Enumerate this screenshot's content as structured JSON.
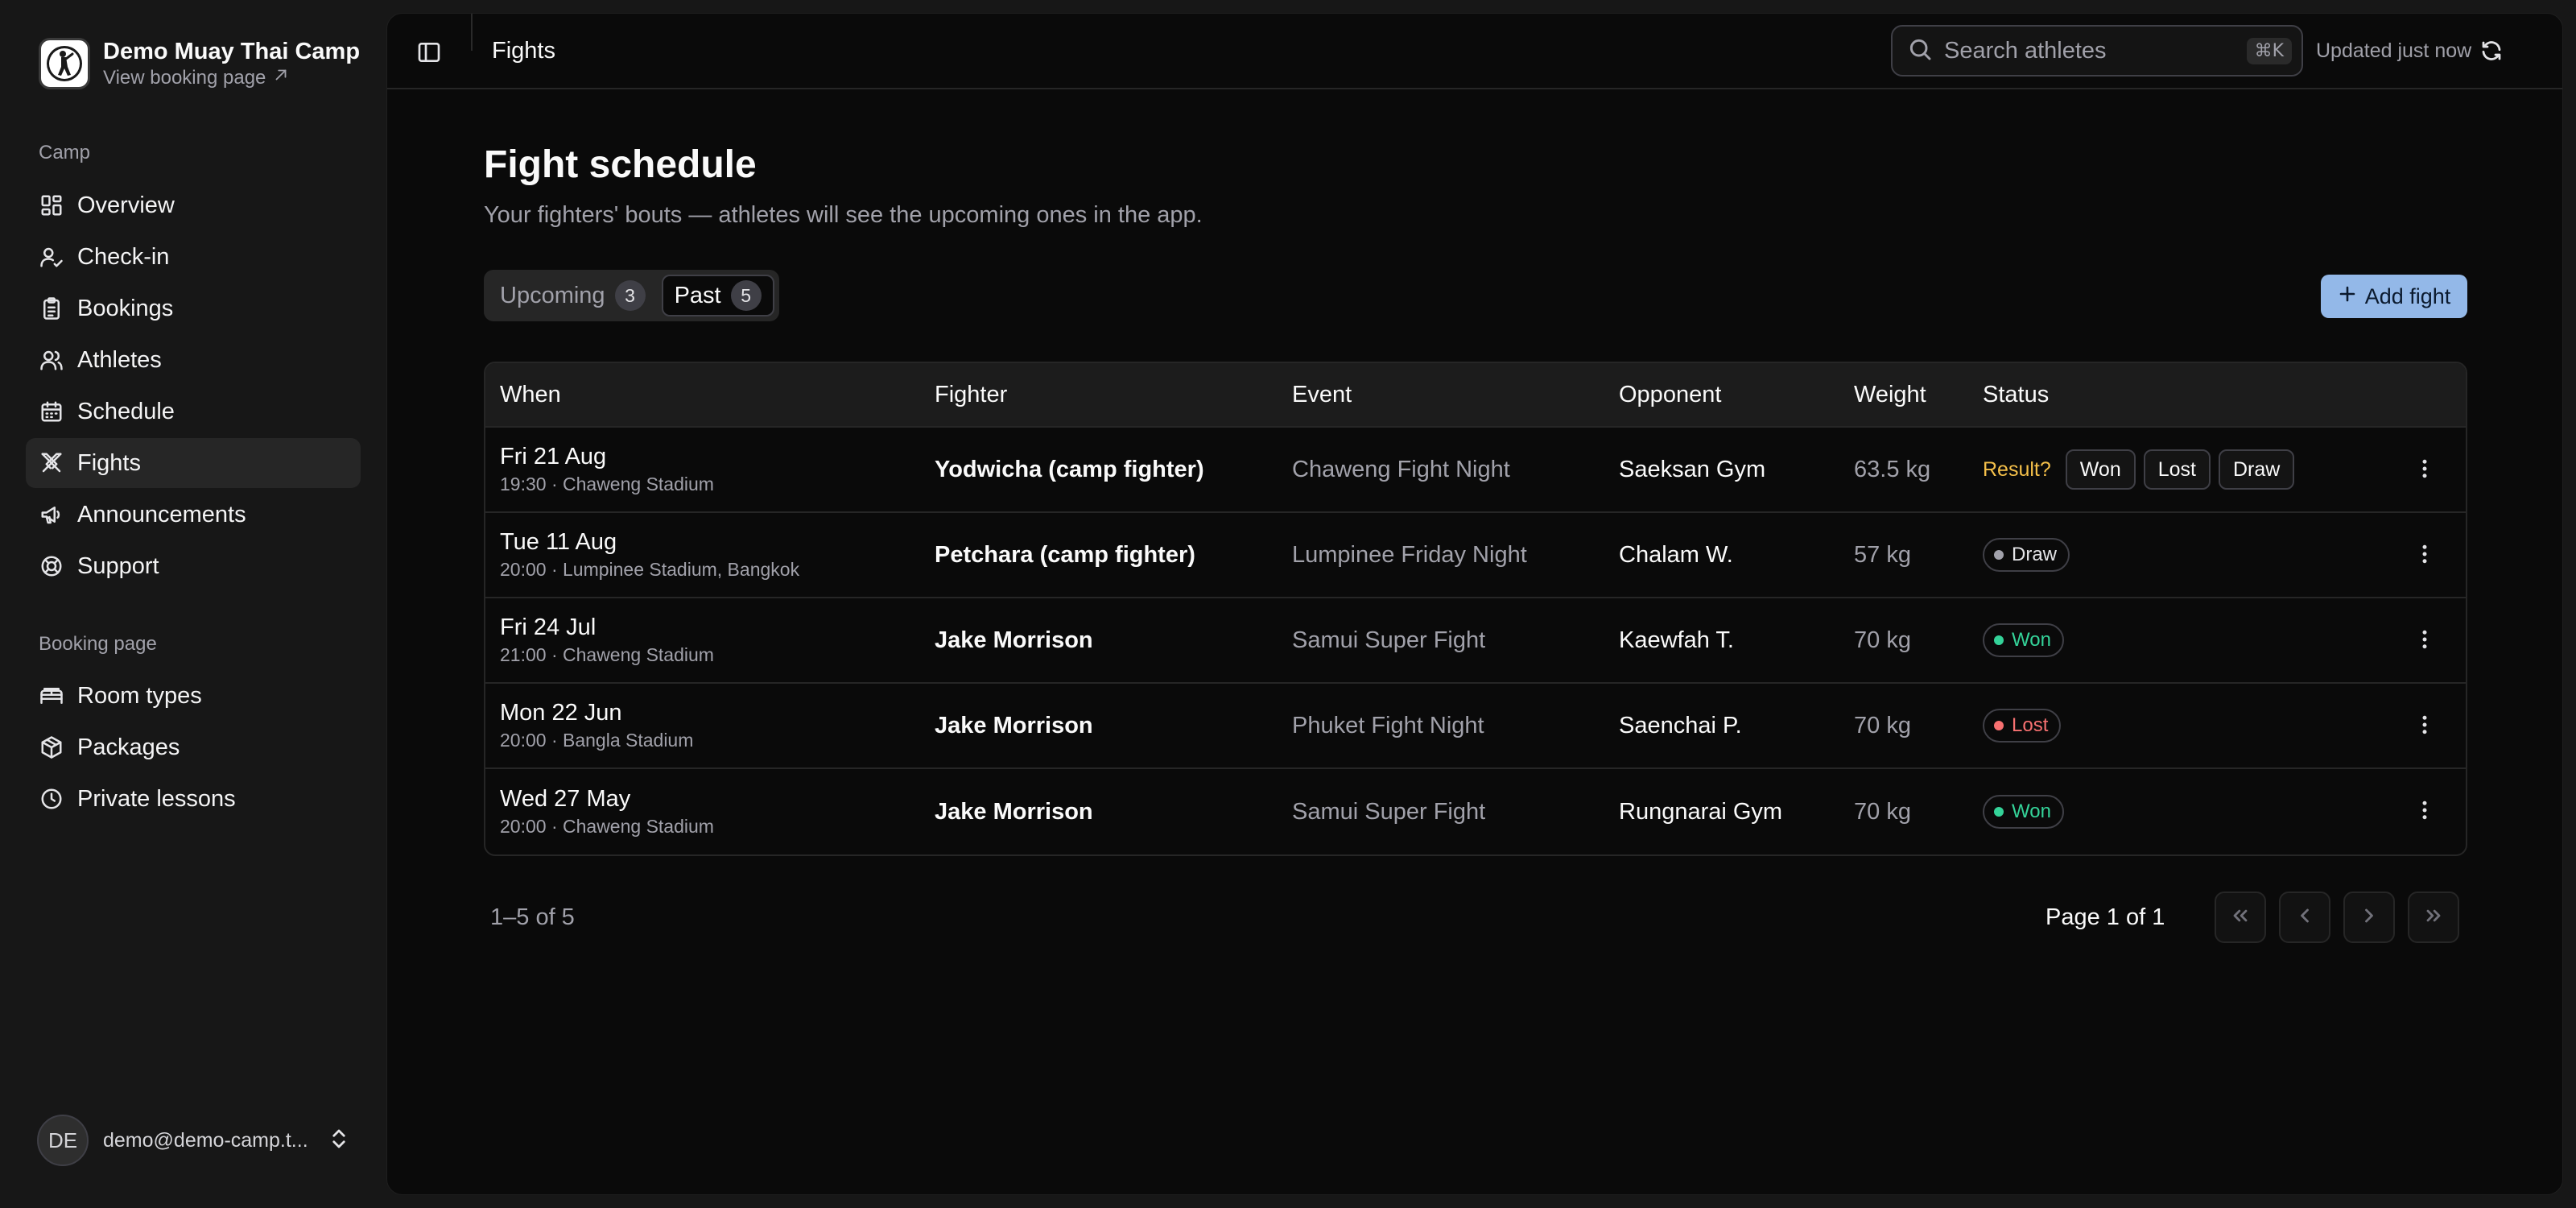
{
  "app": {
    "name": "Demo Muay Thai Camp",
    "booking_link": "View booking page"
  },
  "sidebar": {
    "groups": [
      {
        "label": "Camp",
        "items": [
          {
            "label": "Overview",
            "icon": "grid-icon"
          },
          {
            "label": "Check-in",
            "icon": "user-check-icon"
          },
          {
            "label": "Bookings",
            "icon": "clipboard-icon"
          },
          {
            "label": "Athletes",
            "icon": "users-icon"
          },
          {
            "label": "Schedule",
            "icon": "calendar-icon"
          },
          {
            "label": "Fights",
            "icon": "swords-icon",
            "active": true
          },
          {
            "label": "Announcements",
            "icon": "megaphone-icon"
          },
          {
            "label": "Support",
            "icon": "lifebuoy-icon"
          }
        ]
      },
      {
        "label": "Booking page",
        "items": [
          {
            "label": "Room types",
            "icon": "bed-icon"
          },
          {
            "label": "Packages",
            "icon": "package-icon"
          },
          {
            "label": "Private lessons",
            "icon": "clock-icon"
          }
        ]
      }
    ],
    "user": {
      "initials": "DE",
      "email": "demo@demo-camp.t..."
    }
  },
  "topbar": {
    "page": "Fights",
    "search_placeholder": "Search athletes",
    "shortcut": "⌘K",
    "updated": "Updated just now"
  },
  "page": {
    "title": "Fight schedule",
    "subtitle": "Your fighters' bouts — athletes will see the upcoming ones in the app.",
    "tabs": [
      {
        "label": "Upcoming",
        "count": "3"
      },
      {
        "label": "Past",
        "count": "5",
        "active": true
      }
    ],
    "add_label": "Add fight"
  },
  "table": {
    "columns": [
      "When",
      "Fighter",
      "Event",
      "Opponent",
      "Weight",
      "Status"
    ],
    "rows": [
      {
        "date": "Fri 21 Aug",
        "detail": "19:30 · Chaweng Stadium",
        "fighter": "Yodwicha (camp fighter)",
        "event": "Chaweng Fight Night",
        "opponent": "Saeksan Gym",
        "weight": "63.5 kg",
        "status": "pending",
        "result_prompt": "Result?",
        "actions": [
          "Won",
          "Lost",
          "Draw"
        ]
      },
      {
        "date": "Tue 11 Aug",
        "detail": "20:00 · Lumpinee Stadium, Bangkok",
        "fighter": "Petchara (camp fighter)",
        "event": "Lumpinee Friday Night",
        "opponent": "Chalam W.",
        "weight": "57 kg",
        "status": "Draw"
      },
      {
        "date": "Fri 24 Jul",
        "detail": "21:00 · Chaweng Stadium",
        "fighter": "Jake Morrison",
        "event": "Samui Super Fight",
        "opponent": "Kaewfah T.",
        "weight": "70 kg",
        "status": "Won"
      },
      {
        "date": "Mon 22 Jun",
        "detail": "20:00 · Bangla Stadium",
        "fighter": "Jake Morrison",
        "event": "Phuket Fight Night",
        "opponent": "Saenchai P.",
        "weight": "70 kg",
        "status": "Lost"
      },
      {
        "date": "Wed 27 May",
        "detail": "20:00 · Chaweng Stadium",
        "fighter": "Jake Morrison",
        "event": "Samui Super Fight",
        "opponent": "Rungnarai Gym",
        "weight": "70 kg",
        "status": "Won"
      }
    ]
  },
  "status_colors": {
    "Won": "#34d399",
    "Lost": "#f87171",
    "Draw": "#a1a1aa"
  },
  "pagination": {
    "range": "1–5 of 5",
    "page": "Page 1 of 1"
  }
}
